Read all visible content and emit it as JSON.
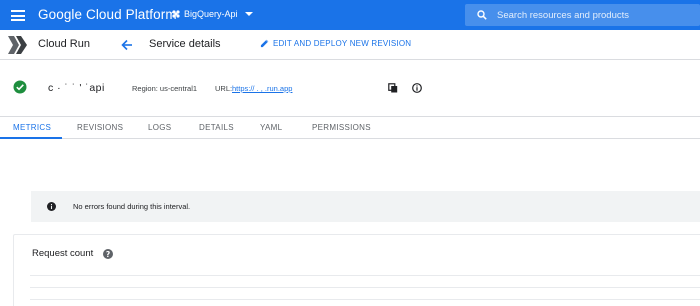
{
  "topbar": {
    "brand": "Google Cloud Platform",
    "project": "BigQuery-Api",
    "search_placeholder": "Search resources and products",
    "accent_color": "#1a73e8",
    "icons": [
      "menu-icon",
      "project-icon",
      "chevron-down-icon",
      "search-icon"
    ]
  },
  "subbar": {
    "product_name": "Cloud Run",
    "page_title": "Service details",
    "edit_label": "EDIT AND DEPLOY NEW REVISION",
    "icons": [
      "cloud-run-logo-icon",
      "back-arrow-icon",
      "pencil-icon"
    ]
  },
  "service": {
    "name": "c · ˙ ˙ ' ˙api",
    "region": "Region: us-central1",
    "url_label": "URL:",
    "url": "https://          .          ,           .run.app",
    "status_color": "#1e8e3e",
    "icons": [
      "check-circle-icon",
      "copy-icon",
      "info-icon"
    ]
  },
  "tabs": [
    {
      "label": "METRICS",
      "active": true
    },
    {
      "label": "REVISIONS",
      "active": false
    },
    {
      "label": "LOGS",
      "active": false
    },
    {
      "label": "DETAILS",
      "active": false
    },
    {
      "label": "YAML",
      "active": false
    },
    {
      "label": "PERMISSIONS",
      "active": false
    }
  ],
  "message": {
    "text": "No errors found during this interval.",
    "icon": "info-icon"
  },
  "card": {
    "title": "Request count",
    "icon": "help-icon"
  }
}
